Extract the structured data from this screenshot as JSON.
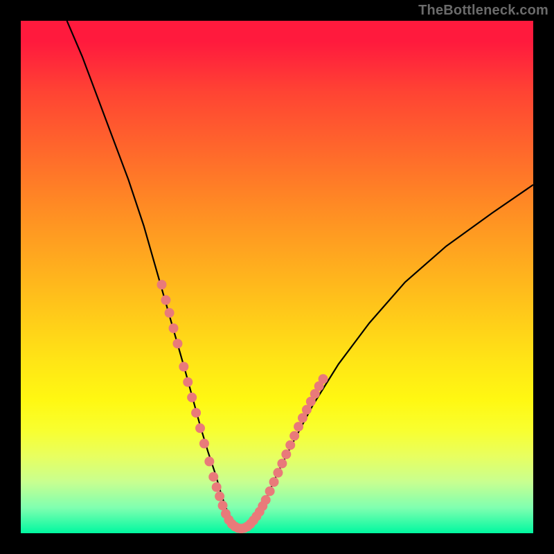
{
  "watermark": "TheBottleneck.com",
  "chart_data": {
    "type": "line",
    "title": "",
    "xlabel": "",
    "ylabel": "",
    "xlim": [
      0,
      100
    ],
    "ylim": [
      0,
      100
    ],
    "grid": false,
    "legend": false,
    "curve_color": "#000000",
    "marker_color": "#e97a7a",
    "series": [
      {
        "name": "bottleneck-curve",
        "x": [
          9,
          12,
          15,
          18,
          21,
          24,
          26,
          28,
          30,
          32,
          33.5,
          35,
          36.5,
          38,
          39,
          40,
          41,
          42,
          43,
          44,
          46,
          48,
          50,
          53,
          57,
          62,
          68,
          75,
          83,
          92,
          100
        ],
        "y": [
          100,
          93,
          85,
          77,
          69,
          60,
          53,
          46,
          39,
          32,
          26.5,
          21,
          16,
          11.5,
          8,
          5,
          3,
          1.5,
          1,
          1.5,
          3.5,
          7,
          11.5,
          17.5,
          25,
          33,
          41,
          49,
          56,
          62.5,
          68
        ]
      }
    ],
    "markers": [
      {
        "name": "left-cluster",
        "points": [
          {
            "x": 27.5,
            "y": 48.5
          },
          {
            "x": 28.3,
            "y": 45.5
          },
          {
            "x": 29.0,
            "y": 43.0
          },
          {
            "x": 29.8,
            "y": 40.0
          },
          {
            "x": 30.6,
            "y": 37.0
          },
          {
            "x": 31.8,
            "y": 32.5
          },
          {
            "x": 32.6,
            "y": 29.5
          },
          {
            "x": 33.4,
            "y": 26.5
          },
          {
            "x": 34.2,
            "y": 23.5
          },
          {
            "x": 35.0,
            "y": 20.5
          },
          {
            "x": 35.8,
            "y": 17.5
          },
          {
            "x": 36.8,
            "y": 14.0
          },
          {
            "x": 37.6,
            "y": 11.0
          },
          {
            "x": 38.2,
            "y": 9.0
          },
          {
            "x": 38.8,
            "y": 7.2
          }
        ]
      },
      {
        "name": "trough-cluster",
        "points": [
          {
            "x": 39.4,
            "y": 5.4
          },
          {
            "x": 40.0,
            "y": 3.8
          },
          {
            "x": 40.6,
            "y": 2.6
          },
          {
            "x": 41.2,
            "y": 1.8
          },
          {
            "x": 41.8,
            "y": 1.3
          },
          {
            "x": 42.4,
            "y": 1.0
          },
          {
            "x": 43.0,
            "y": 0.9
          },
          {
            "x": 43.6,
            "y": 1.0
          },
          {
            "x": 44.2,
            "y": 1.3
          },
          {
            "x": 44.8,
            "y": 1.8
          },
          {
            "x": 45.4,
            "y": 2.5
          },
          {
            "x": 46.0,
            "y": 3.3
          },
          {
            "x": 46.6,
            "y": 4.2
          },
          {
            "x": 47.2,
            "y": 5.3
          },
          {
            "x": 47.8,
            "y": 6.5
          }
        ]
      },
      {
        "name": "right-cluster",
        "points": [
          {
            "x": 48.6,
            "y": 8.2
          },
          {
            "x": 49.4,
            "y": 10.0
          },
          {
            "x": 50.2,
            "y": 11.8
          },
          {
            "x": 51.0,
            "y": 13.6
          },
          {
            "x": 51.8,
            "y": 15.4
          },
          {
            "x": 52.6,
            "y": 17.2
          },
          {
            "x": 53.4,
            "y": 19.0
          },
          {
            "x": 54.2,
            "y": 20.8
          },
          {
            "x": 55.0,
            "y": 22.5
          },
          {
            "x": 55.8,
            "y": 24.1
          },
          {
            "x": 56.6,
            "y": 25.7
          },
          {
            "x": 57.4,
            "y": 27.2
          },
          {
            "x": 58.2,
            "y": 28.7
          },
          {
            "x": 59.0,
            "y": 30.1
          }
        ]
      }
    ]
  }
}
